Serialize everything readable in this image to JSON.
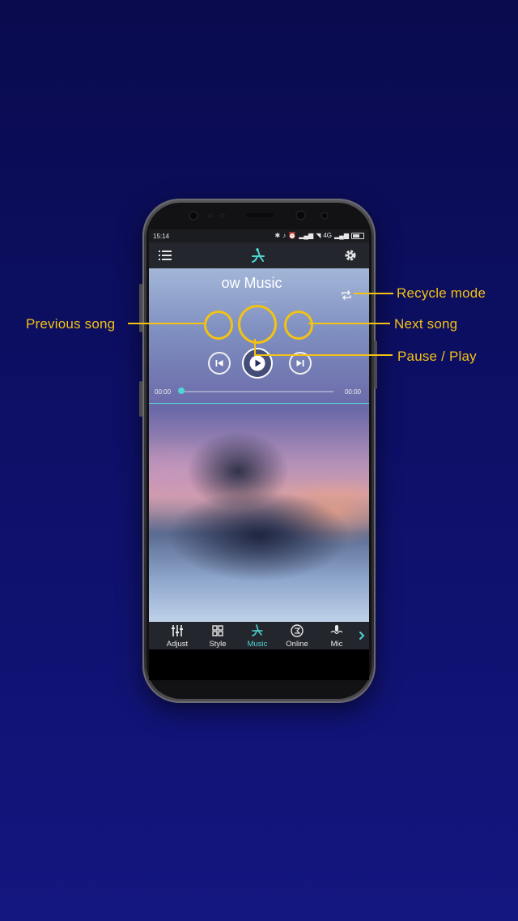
{
  "status_bar": {
    "time": "15:14",
    "network": "4G",
    "icons": [
      "bluetooth-icon",
      "silent-icon",
      "alarm-icon",
      "signal-icon",
      "wifi-icon",
      "signal-icon",
      "battery-icon"
    ]
  },
  "app_bar": {
    "menu_icon": "menu-icon",
    "logo_icon": "music-note-icon",
    "settings_icon": "gear-icon"
  },
  "player": {
    "song_title": "ow Music",
    "dots": "......",
    "elapsed": "00:00",
    "duration": "00:00",
    "progress": 0
  },
  "tabs": [
    {
      "label": "Adjust",
      "icon": "equalizer-icon"
    },
    {
      "label": "Style",
      "icon": "grid-icon"
    },
    {
      "label": "Music",
      "icon": "music-note-icon",
      "active": true
    },
    {
      "label": "Online",
      "icon": "online-icon"
    },
    {
      "label": "Mic",
      "icon": "mic-icon"
    }
  ],
  "callouts": {
    "recycle_mode": "Recycle mode",
    "previous_song": "Previous song",
    "next_song": "Next song",
    "pause_play": "Pause / Play"
  },
  "colors": {
    "accent": "#4fd6d2",
    "callout": "#f3c213",
    "background_top": "#0a0b4e",
    "background_bottom": "#141680",
    "app_bar": "#23262d"
  }
}
